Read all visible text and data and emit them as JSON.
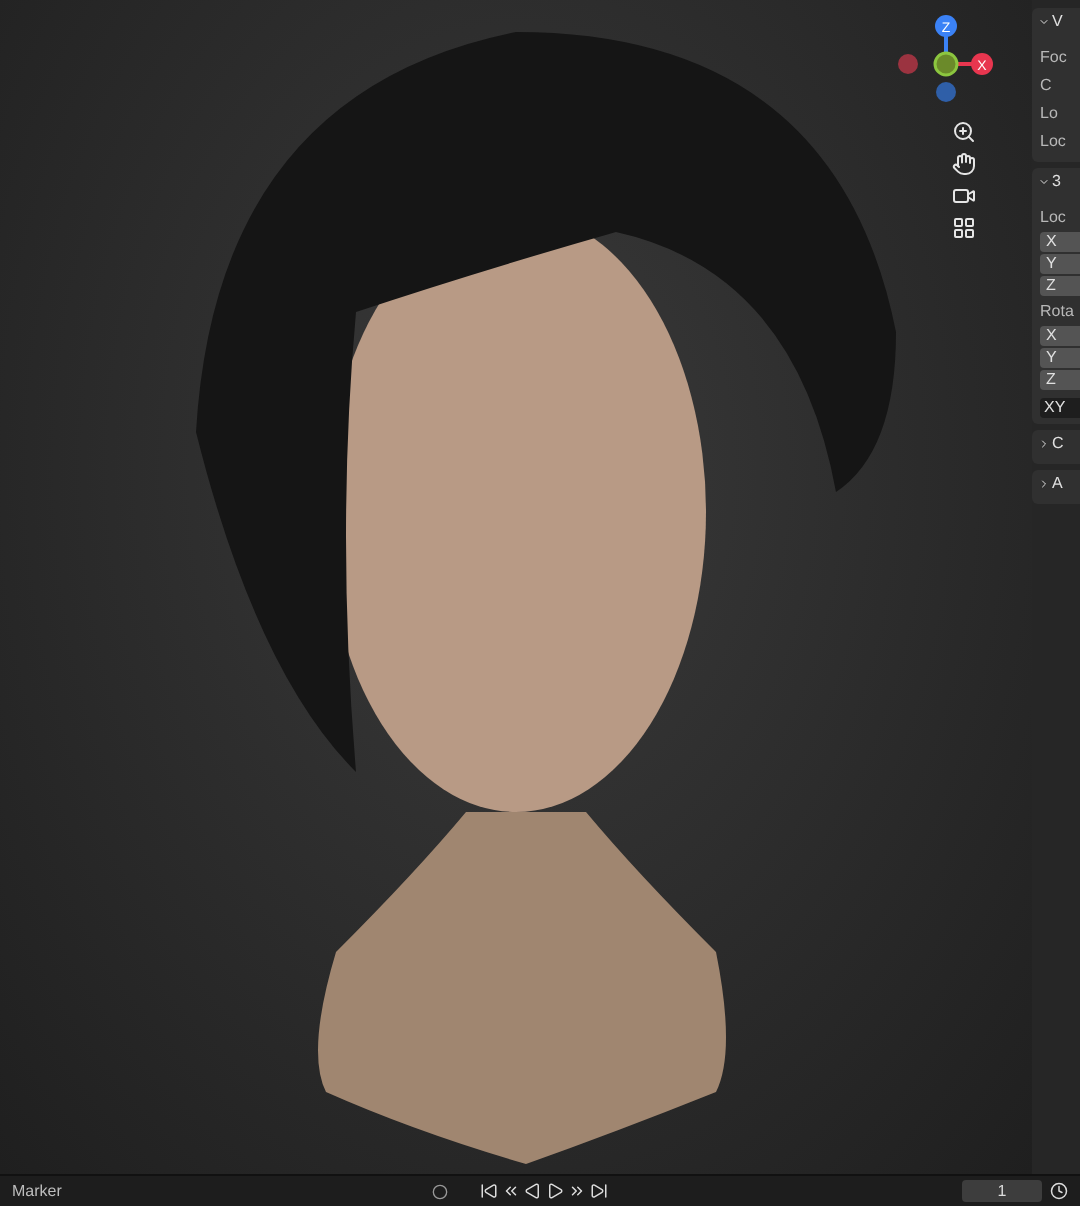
{
  "viewport": {
    "gizmo": {
      "z_label": "Z",
      "x_label": "X"
    }
  },
  "side_panel": {
    "sections": [
      {
        "title": "V",
        "expanded": true,
        "rows": [
          {
            "kind": "label",
            "text": "Foc"
          },
          {
            "kind": "label",
            "text": "C"
          },
          {
            "kind": "label",
            "text": "Lo"
          },
          {
            "kind": "label",
            "text": "Loc"
          }
        ]
      },
      {
        "title": "3",
        "expanded": true,
        "rows": [
          {
            "kind": "label",
            "text": "Loc"
          },
          {
            "kind": "field",
            "text": "X"
          },
          {
            "kind": "field",
            "text": "Y"
          },
          {
            "kind": "field",
            "text": "Z"
          },
          {
            "kind": "label",
            "text": "Rota"
          },
          {
            "kind": "field",
            "text": "X"
          },
          {
            "kind": "field",
            "text": "Y"
          },
          {
            "kind": "field",
            "text": "Z"
          },
          {
            "kind": "dropdown",
            "text": "XY"
          }
        ]
      },
      {
        "title": "C",
        "expanded": false
      },
      {
        "title": "A",
        "expanded": false
      }
    ]
  },
  "timeline": {
    "menu": "Marker",
    "frame": "1"
  }
}
